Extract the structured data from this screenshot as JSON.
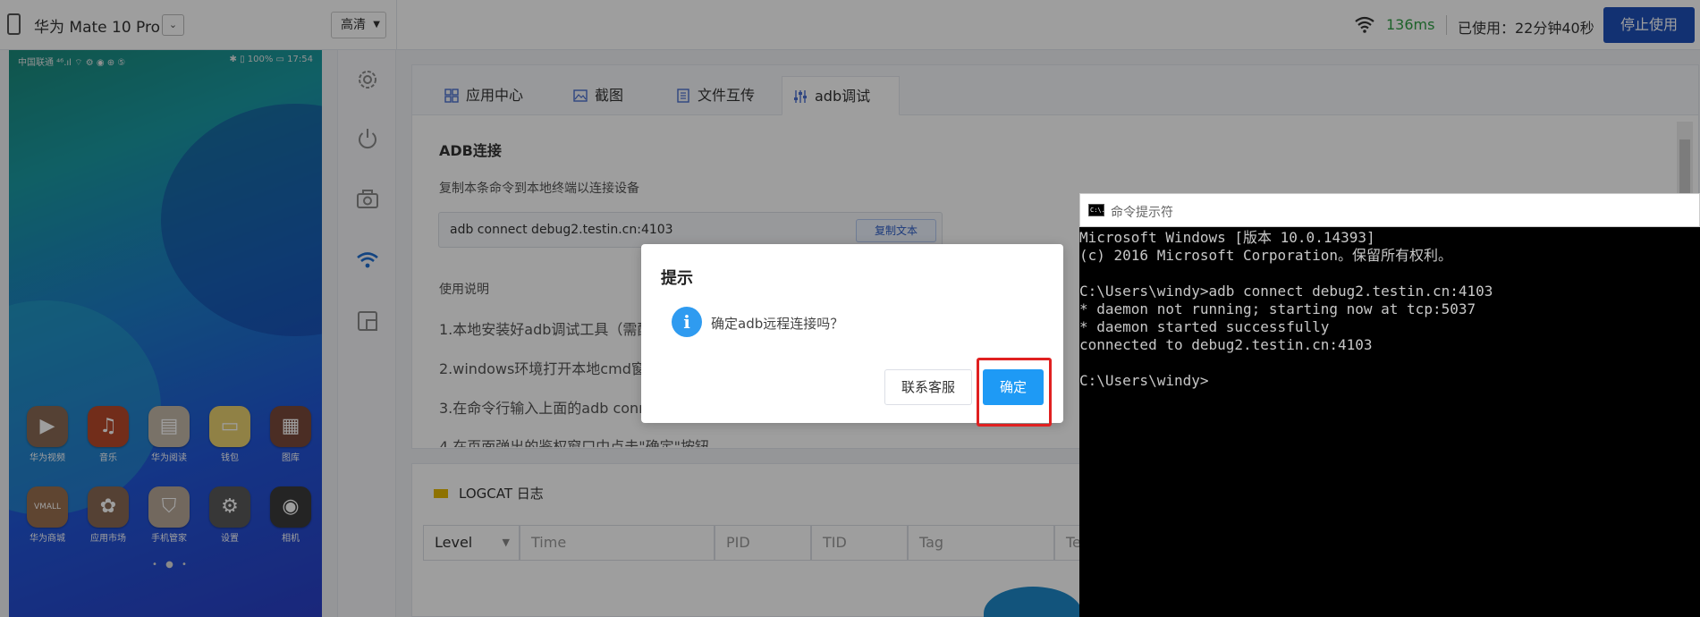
{
  "topbar": {
    "device_name": "华为 Mate 10 Pro",
    "dropdown_caret": "⌄",
    "quality": "高清",
    "latency": "136ms",
    "usage": "已使用：22分钟40秒",
    "stop_button": "停止使用"
  },
  "phone": {
    "status_carrier": "中国联通 ⁴⁶.ıl ⌔ ⚙ ◉ ⊕ ⑤",
    "status_right": "✱ ▯ 100% ▭ 17:54",
    "apps": [
      {
        "label": "华为视频",
        "glyph": "▶",
        "color": "#8a6a55"
      },
      {
        "label": "音乐",
        "glyph": "♫",
        "color": "#b84a2a"
      },
      {
        "label": "华为阅读",
        "glyph": "▤",
        "color": "#c4b8a8"
      },
      {
        "label": "钱包",
        "glyph": "▭",
        "color": "#e8d070"
      },
      {
        "label": "图库",
        "glyph": "▦",
        "color": "#7a4a3a"
      },
      {
        "label": "华为商城",
        "glyph": "VMALL",
        "color": "#9a7050"
      },
      {
        "label": "应用市场",
        "glyph": "✿",
        "color": "#8a6a55"
      },
      {
        "label": "手机管家",
        "glyph": "⛉",
        "color": "#b8a898"
      },
      {
        "label": "设置",
        "glyph": "⚙",
        "color": "#5a5a5a"
      },
      {
        "label": "相机",
        "glyph": "◉",
        "color": "#3a3a3a"
      }
    ],
    "dots": "• ● •"
  },
  "tabs": [
    {
      "label": "应用中心"
    },
    {
      "label": "截图"
    },
    {
      "label": "文件互传"
    },
    {
      "label": "adb调试"
    }
  ],
  "adb": {
    "title": "ADB连接",
    "desc": "复制本条命令到本地终端以连接设备",
    "command": "adb connect debug2.testin.cn:4103",
    "copy_button": "复制文本",
    "usage_title": "使用说明",
    "steps": [
      "1.本地安装好adb调试工具（需配",
      "2.windows环境打开本地cmd窗口",
      "3.在命令行输入上面的adb conn",
      "4.在页面弹出的鉴权窗口中点击\"确定\"按钮。"
    ]
  },
  "logcat": {
    "title": "LOGCAT 日志",
    "level": "Level",
    "time": "Time",
    "pid": "PID",
    "tid": "TID",
    "tag": "Tag",
    "text": "Te"
  },
  "dialog": {
    "title": "提示",
    "icon": "i",
    "message": "确定adb远程连接吗？",
    "contact_button": "联系客服",
    "ok_button": "确定"
  },
  "cmd": {
    "icon_text": "C:\\.",
    "title": "命令提示符",
    "lines": [
      "Microsoft Windows [版本 10.0.14393]",
      "(c) 2016 Microsoft Corporation。保留所有权利。",
      "",
      "C:\\Users\\windy>adb connect debug2.testin.cn:4103",
      "* daemon not running; starting now at tcp:5037",
      "* daemon started successfully",
      "connected to debug2.testin.cn:4103",
      "",
      "C:\\Users\\windy>"
    ]
  },
  "colors": {
    "accent_blue": "#1e4fb8",
    "ok_blue": "#1e9af5",
    "highlight_red": "#e02020",
    "latency_green": "#2f9e44"
  }
}
